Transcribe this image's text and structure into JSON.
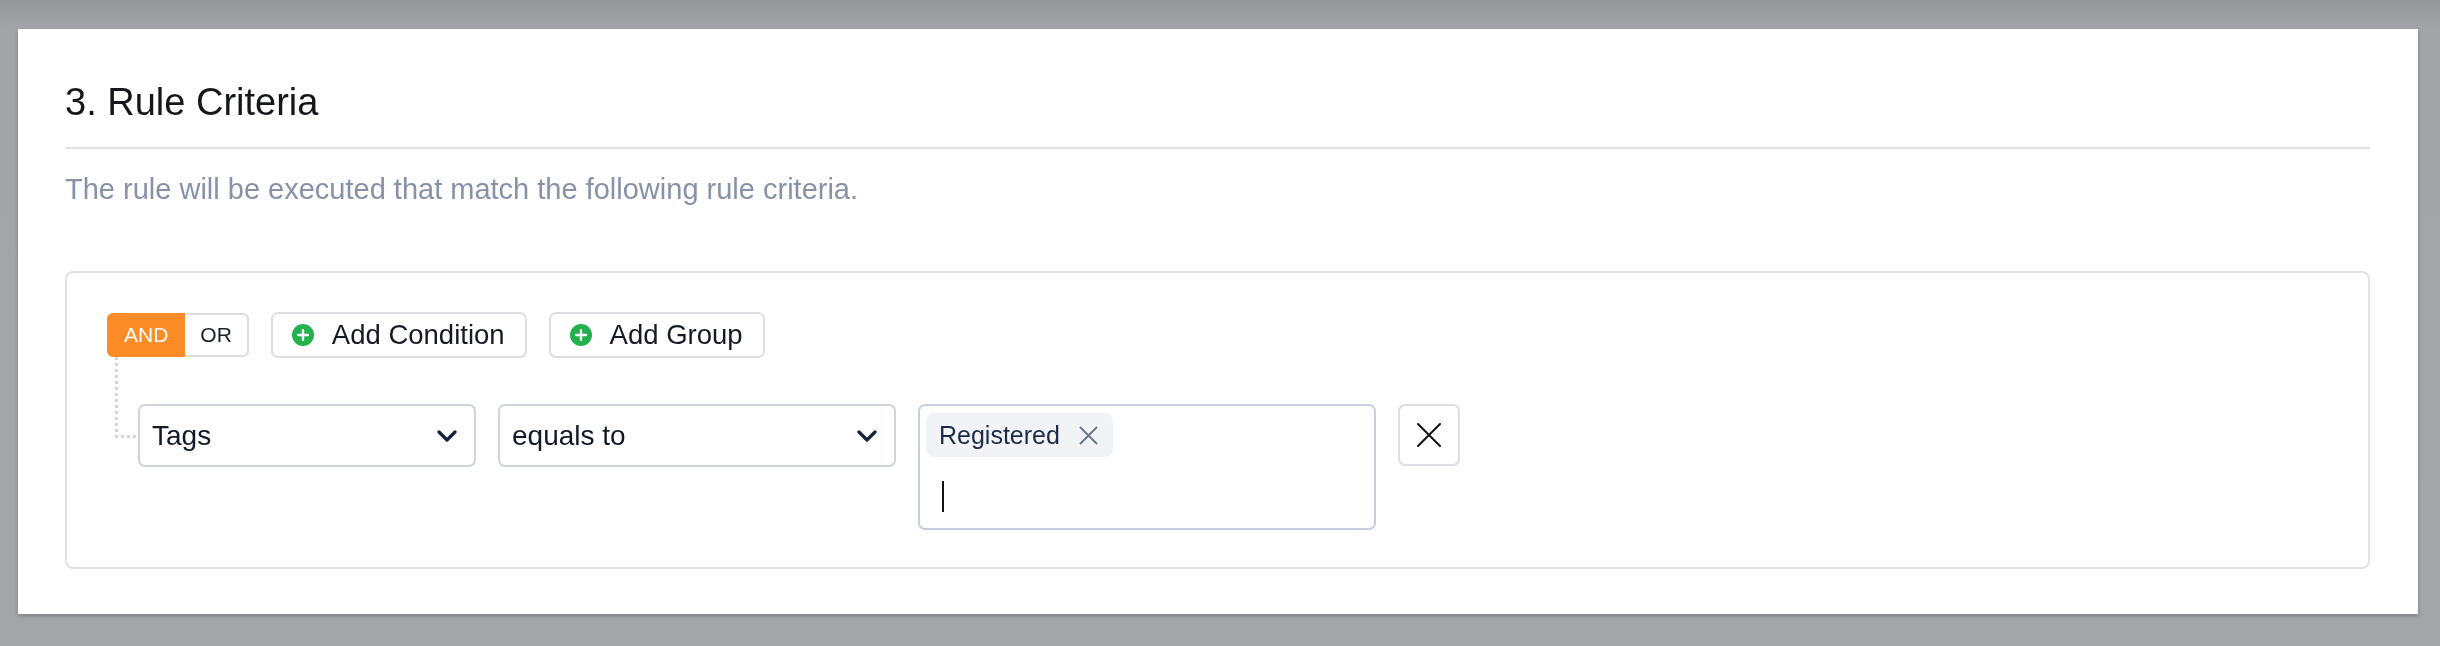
{
  "section": {
    "title": "3. Rule Criteria",
    "description": "The rule will be executed that match the following rule criteria."
  },
  "criteria": {
    "operators": [
      {
        "label": "AND",
        "selected": true
      },
      {
        "label": "OR",
        "selected": false
      }
    ],
    "actions": [
      {
        "label": "Add Condition"
      },
      {
        "label": "Add Group"
      }
    ],
    "conditions": [
      {
        "field": "Tags",
        "operator": "equals to",
        "values": [
          "Registered"
        ],
        "focused": true
      }
    ]
  }
}
